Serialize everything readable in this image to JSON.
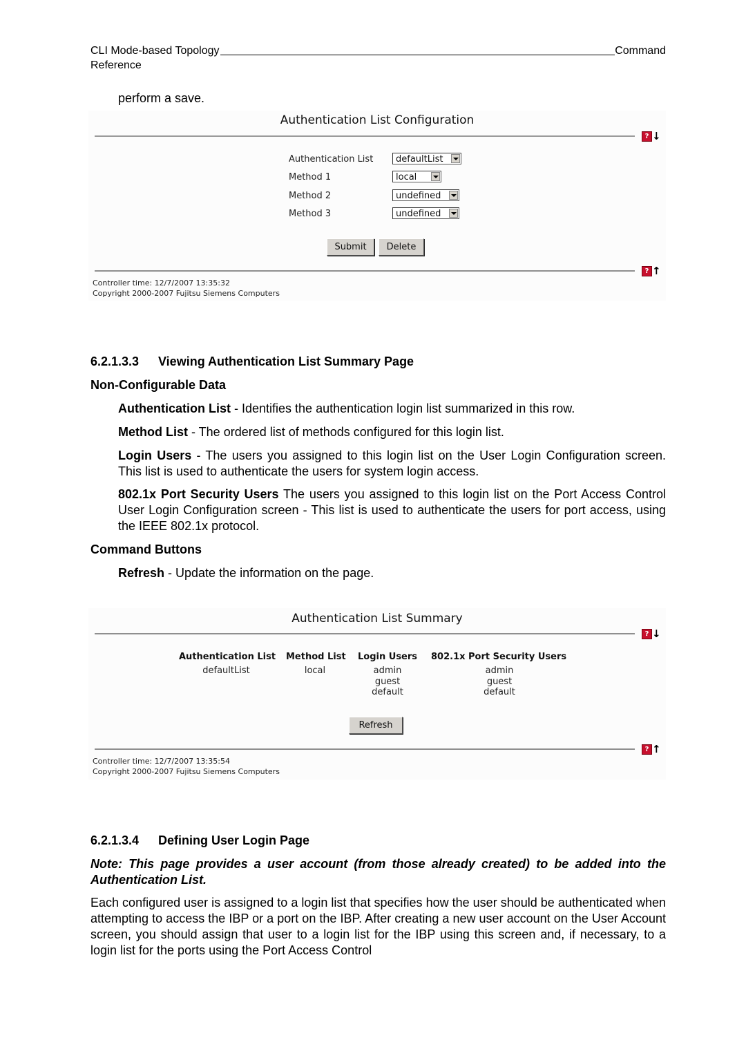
{
  "header": {
    "left": "CLI Mode-based Topology",
    "right": "Command",
    "second_line": "Reference"
  },
  "intro_text": "perform a save.",
  "config_panel": {
    "title": "Authentication List Configuration",
    "fields": [
      {
        "label": "Authentication List",
        "value": "defaultList"
      },
      {
        "label": "Method 1",
        "value": "local"
      },
      {
        "label": "Method 2",
        "value": "undefined"
      },
      {
        "label": "Method 3",
        "value": "undefined"
      }
    ],
    "buttons": {
      "submit": "Submit",
      "delete": "Delete"
    },
    "help_icon": "?",
    "controller_time": "Controller time: 12/7/2007 13:35:32",
    "copyright": "Copyright 2000-2007 Fujitsu Siemens Computers"
  },
  "section_summary": {
    "number": "6.2.1.3.3",
    "title": "Viewing Authentication List Summary Page",
    "subheading": "Non-Configurable Data",
    "items": [
      {
        "term": "Authentication List",
        "text": " - Identifies the authentication login list summarized in this row."
      },
      {
        "term": "Method List",
        "text": " - The ordered list of methods configured for this login list."
      },
      {
        "term": "Login Users",
        "text": " - The users you assigned to this login list on the User Login Configuration screen. This list is used to authenticate the users for system login access."
      },
      {
        "term": "802.1x Port Security Users",
        "text": " The users you assigned to this login list on the Port Access Control User Login Configuration screen - This list is used to authenticate the users for port access, using the IEEE 802.1x protocol."
      }
    ],
    "command_heading": "Command Buttons",
    "commands": [
      {
        "term": "Refresh",
        "text": " - Update the information on the page."
      }
    ]
  },
  "summary_panel": {
    "title": "Authentication List Summary",
    "columns": [
      "Authentication List",
      "Method List",
      "Login Users",
      "802.1x Port Security Users"
    ],
    "rows": [
      {
        "authentication_list": "defaultList",
        "method_list": "local",
        "login_users": [
          "admin",
          "guest",
          "default"
        ],
        "port_security_users": [
          "admin",
          "guest",
          "default"
        ]
      }
    ],
    "refresh_button": "Refresh",
    "help_icon": "?",
    "controller_time": "Controller time: 12/7/2007 13:35:54",
    "copyright": "Copyright 2000-2007 Fujitsu Siemens Computers"
  },
  "section_user_login": {
    "number": "6.2.1.3.4",
    "title": "Defining User Login Page",
    "note": "Note: This page provides a user account (from those already created) to be added into the Authentication List.",
    "body": "Each configured user is assigned to a login list that specifies how the user should be authenticated when attempting to access the IBP or a port on the IBP. After creating a new user account on the User Account screen, you should assign that user to a login list for the IBP using this screen and, if necessary, to a login list for the ports using the Port Access Control"
  }
}
